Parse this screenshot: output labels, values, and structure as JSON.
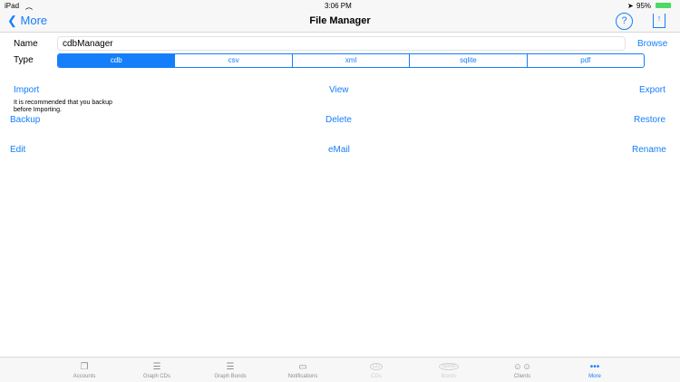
{
  "status": {
    "device": "iPad",
    "time": "3:06 PM",
    "battery": "95%"
  },
  "nav": {
    "back": "More",
    "title": "File Manager"
  },
  "form": {
    "name_label": "Name",
    "name_value": "cdbManager",
    "browse": "Browse",
    "type_label": "Type",
    "types": [
      "cdb",
      "csv",
      "xml",
      "sqlite",
      "pdf"
    ],
    "selected": "cdb"
  },
  "actions": {
    "import": "Import",
    "view": "View",
    "export": "Export",
    "note": "It is recommended that you backup before Importing.",
    "backup": "Backup",
    "delete": "Delete",
    "restore": "Restore",
    "edit": "Edit",
    "email": "eMail",
    "rename": "Rename"
  },
  "tabs": [
    {
      "label": "Accounts"
    },
    {
      "label": "Graph CDs"
    },
    {
      "label": "Graph Bonds"
    },
    {
      "label": "Notifications"
    },
    {
      "label": "CDs",
      "icon_text": "CD"
    },
    {
      "label": "Bonds",
      "icon_text": "Bond"
    },
    {
      "label": "Clients"
    },
    {
      "label": "More"
    }
  ],
  "colors": {
    "accent": "#147efb"
  }
}
